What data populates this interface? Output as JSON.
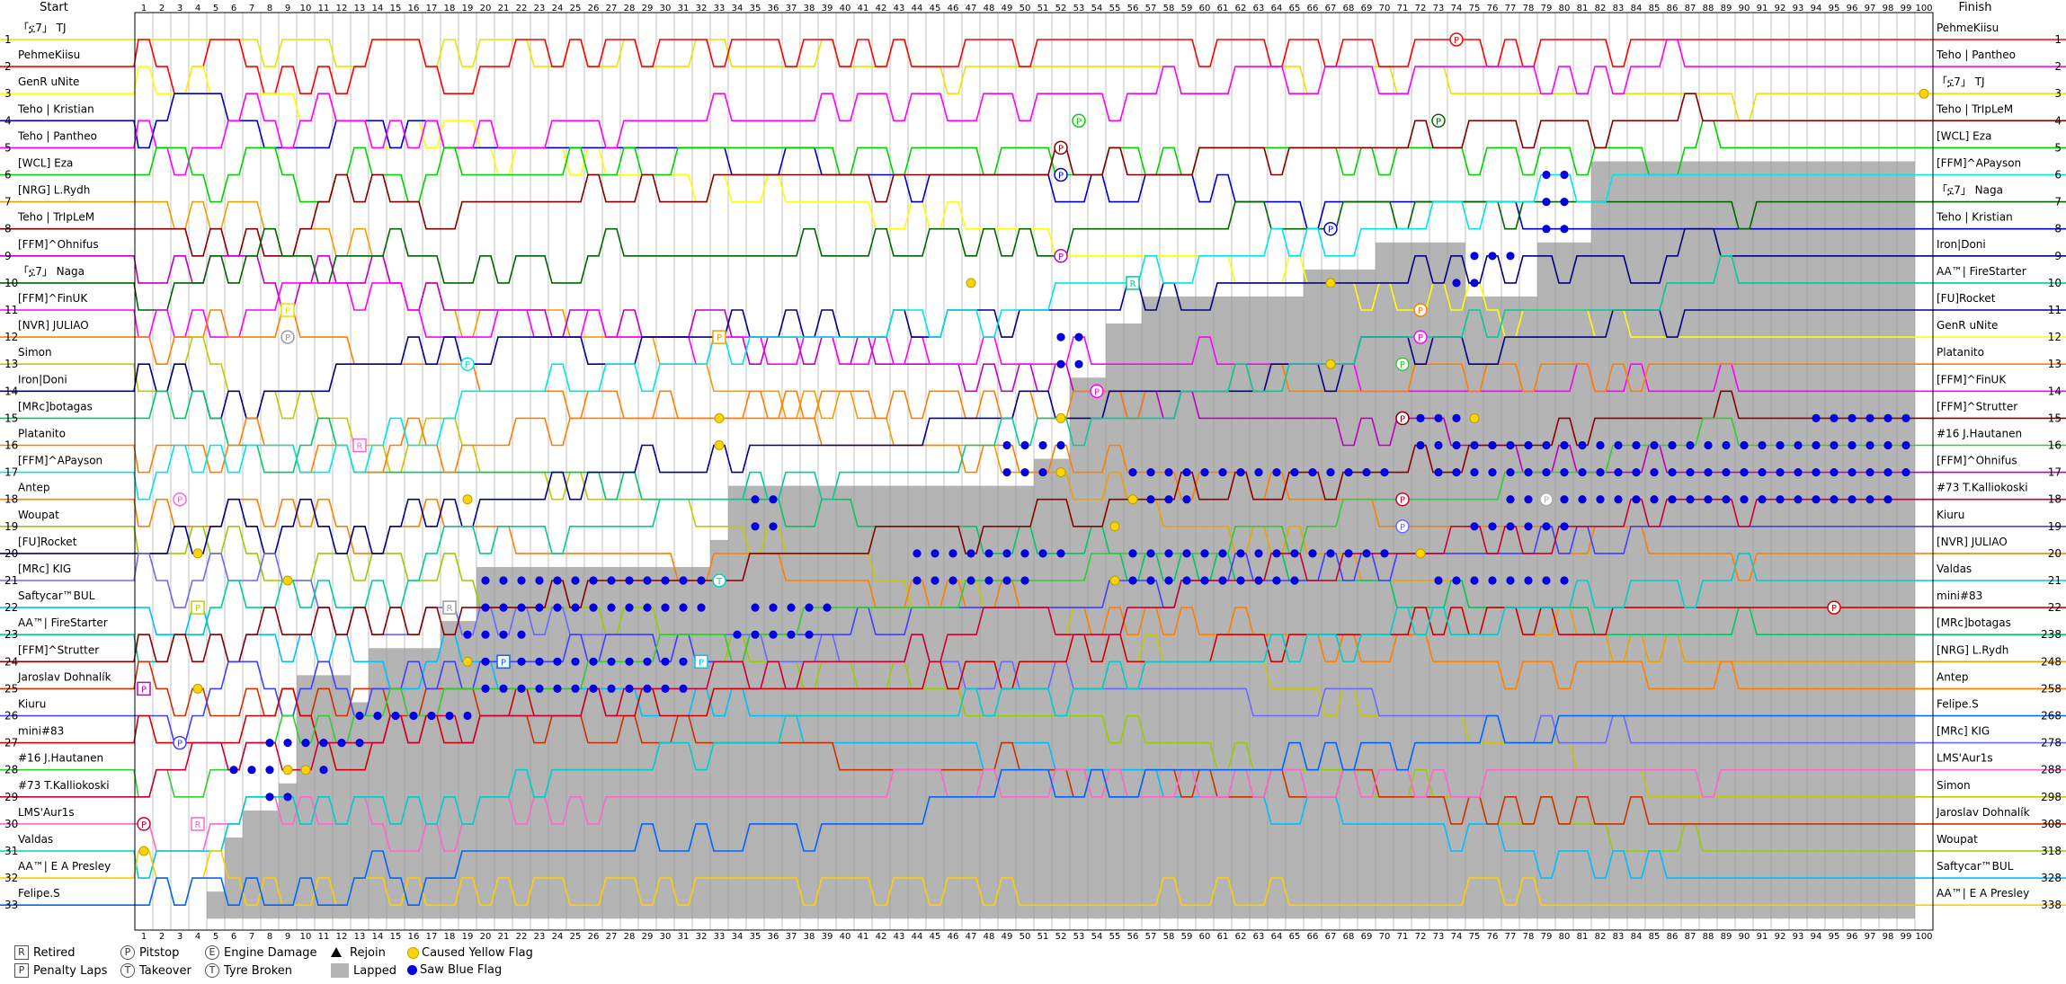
{
  "chart_data": {
    "type": "line",
    "title": "",
    "header_left": "Start",
    "header_right": "Finish",
    "laps": 100,
    "positions": 33,
    "start_order": [
      "「ኗ7」 TJ",
      "PehmeKiisu",
      "GenR uNite",
      "Teho | Kristian",
      "Teho | Pantheo",
      "[WCL] Eza",
      "[NRG] L.Rydh",
      "Teho | TrIpLeM",
      "[FFM]^Ohnifus",
      "「ኗ7」 Naga",
      "[FFM]^FinUK",
      "[NVR] JULIAO",
      "Simon",
      "Iron|Doni",
      "[MRc]botagas",
      "Platanito",
      "[FFM]^APayson",
      "Antep",
      "Woupat",
      "[FU]Rocket",
      "[MRc] KIG",
      "Saftycar™BUL",
      "AA™| FireStarter",
      "[FFM]^Strutter",
      "Jaroslav Dohnalík",
      "Kiuru",
      "mini#83",
      "#16 J.Hautanen",
      "#73 T.Kalliokoski",
      "LMS'Aur1s",
      "Valdas",
      "AA™| E A Presley",
      "Felipe.S"
    ],
    "finish_order": [
      "PehmeKiisu",
      "Teho | Pantheo",
      "「ኗ7」 TJ",
      "Teho | TrIpLeM",
      "[WCL] Eza",
      "[FFM]^APayson",
      "「ኗ7」 Naga",
      "Teho | Kristian",
      "Iron|Doni",
      "AA™| FireStarter",
      "[FU]Rocket",
      "GenR uNite",
      "Platanito",
      "[FFM]^FinUK",
      "[FFM]^Strutter",
      "#16 J.Hautanen",
      "[FFM]^Ohnifus",
      "#73 T.Kalliokoski",
      "Kiuru",
      "[NVR] JULIAO",
      "Valdas",
      "mini#83",
      "[MRc]botagas",
      "[NRG] L.Rydh",
      "Antep",
      "Felipe.S",
      "[MRc] KIG",
      "LMS'Aur1s",
      "Simon",
      "Jaroslav Dohnalík",
      "Woupat",
      "Saftycar™BUL",
      "AA™| E A Presley"
    ],
    "finish_labels": [
      "1",
      "2",
      "3",
      "4",
      "5",
      "6",
      "7",
      "8",
      "9",
      "10",
      "11",
      "12",
      "13",
      "14",
      "15",
      "16",
      "17",
      "18",
      "19",
      "20",
      "21",
      "22",
      "238",
      "248",
      "258",
      "268",
      "278",
      "288",
      "298",
      "308",
      "318",
      "328",
      "338"
    ],
    "driver_colors": {
      "「ኗ7」 TJ": "#e6e600",
      "PehmeKiisu": "#ff0000",
      "GenR uNite": "#ffff00",
      "Teho | Kristian": "#0000c8",
      "Teho | Pantheo": "#ff00ff",
      "[WCL] Eza": "#00d200",
      "[NRG] L.Rydh": "#f0a000",
      "Teho | TrIpLeM": "#800000",
      "[FFM]^Ohnifus": "#c000c0",
      "「ኗ7」 Naga": "#006400",
      "[FFM]^FinUK": "#ff00ff",
      "[NVR] JULIAO": "#ff8000",
      "Simon": "#c8c800",
      "Iron|Doni": "#000080",
      "[MRc]botagas": "#00c864",
      "Platanito": "#ff8000",
      "[FFM]^APayson": "#00e6e6",
      "Antep": "#ff7f00",
      "Woupat": "#99cc00",
      "[FU]Rocket": "#00008b",
      "[MRc] KIG": "#6a6aff",
      "Saftycar™BUL": "#00bfff",
      "AA™| FireStarter": "#00cc99",
      "[FFM]^Strutter": "#8b0000",
      "Jaroslav Dohnalík": "#cc3300",
      "Kiuru": "#4040ff",
      "mini#83": "#d20000",
      "#16 J.Hautanen": "#33cc33",
      "#73 T.Kalliokoski": "#cc0033",
      "LMS'Aur1s": "#ff66cc",
      "Valdas": "#00cccc",
      "AA™| E A Presley": "#ffcc00",
      "Felipe.S": "#0066ff"
    },
    "lapped_steps": [
      [
        5,
        33
      ],
      [
        6,
        31
      ],
      [
        7,
        30
      ],
      [
        9,
        29
      ],
      [
        10,
        25
      ],
      [
        13,
        26
      ],
      [
        14,
        24
      ],
      [
        18,
        23
      ],
      [
        20,
        21
      ],
      [
        33,
        20
      ],
      [
        34,
        18
      ],
      [
        51,
        17
      ],
      [
        53,
        14
      ],
      [
        55,
        12
      ],
      [
        57,
        11
      ],
      [
        66,
        10
      ],
      [
        70,
        9
      ],
      [
        75,
        11
      ],
      [
        79,
        9
      ],
      [
        82,
        6
      ],
      [
        100,
        6
      ]
    ],
    "markers": [
      {
        "type": "pitstop",
        "lap": 52,
        "pos": 5,
        "color": "#800000"
      },
      {
        "type": "pitstop",
        "lap": 52,
        "pos": 6,
        "color": "#0000c8"
      },
      {
        "type": "pitstop",
        "lap": 52,
        "pos": 9,
        "color": "#c000c0"
      },
      {
        "type": "pitstop",
        "lap": 53,
        "pos": 4,
        "color": "#00d200"
      },
      {
        "type": "pitstop",
        "lap": 73,
        "pos": 4,
        "color": "#006400"
      },
      {
        "type": "pitstop",
        "lap": 74,
        "pos": 1,
        "color": "#ff0000"
      },
      {
        "type": "pitstop",
        "lap": 67,
        "pos": 8,
        "color": "#0000c8"
      },
      {
        "type": "pitstop",
        "lap": 54,
        "pos": 14,
        "color": "#ff00ff"
      },
      {
        "type": "pitstop",
        "lap": 71,
        "pos": 15,
        "color": "#800000"
      },
      {
        "type": "pitstop",
        "lap": 71,
        "pos": 18,
        "color": "#cc0033"
      },
      {
        "type": "pitstop",
        "lap": 79,
        "pos": 18,
        "color": "#aaaaaa"
      },
      {
        "type": "pitstop",
        "lap": 95,
        "pos": 22,
        "color": "#d20000"
      },
      {
        "type": "pitstop",
        "lap": 72,
        "pos": 11,
        "color": "#ff8000"
      },
      {
        "type": "pitstop",
        "lap": 72,
        "pos": 12,
        "color": "#ff00ff"
      },
      {
        "type": "pitstop",
        "lap": 19,
        "pos": 13,
        "color": "#00e6e6"
      },
      {
        "type": "pitstop",
        "lap": 9,
        "pos": 12,
        "color": "#999999"
      },
      {
        "type": "pitstop",
        "lap": 3,
        "pos": 18,
        "color": "#ff66cc"
      },
      {
        "type": "pitstop",
        "lap": 3,
        "pos": 27,
        "color": "#4040ff"
      },
      {
        "type": "pitstop",
        "lap": 1,
        "pos": 30,
        "color": "#cc0033"
      },
      {
        "type": "pitstop",
        "lap": 71,
        "pos": 13,
        "color": "#33cc33"
      },
      {
        "type": "pitstop",
        "lap": 71,
        "pos": 19,
        "color": "#6a6aff"
      },
      {
        "type": "retired",
        "lap": 13,
        "pos": 16,
        "color": "#ff66cc"
      },
      {
        "type": "retired",
        "lap": 18,
        "pos": 22,
        "color": "#999999"
      },
      {
        "type": "retired",
        "lap": 4,
        "pos": 30,
        "color": "#ff66cc"
      },
      {
        "type": "retired",
        "lap": 56,
        "pos": 10,
        "color": "#00cc99"
      },
      {
        "type": "penalty",
        "lap": 1,
        "pos": 25,
        "color": "#c000c0"
      },
      {
        "type": "penalty",
        "lap": 4,
        "pos": 22,
        "color": "#cccc00"
      },
      {
        "type": "penalty",
        "lap": 9,
        "pos": 11,
        "color": "#e6e600"
      },
      {
        "type": "penalty",
        "lap": 33,
        "pos": 12,
        "color": "#f0a000"
      },
      {
        "type": "penalty",
        "lap": 21,
        "pos": 24,
        "color": "#0066ff"
      },
      {
        "type": "penalty",
        "lap": 32,
        "pos": 24,
        "color": "#00bfff"
      },
      {
        "type": "takeover",
        "lap": 33,
        "pos": 21,
        "color": "#00cccc"
      }
    ],
    "yellow_flags": [
      [
        1,
        30
      ],
      [
        1,
        31
      ],
      [
        9,
        28
      ],
      [
        10,
        28
      ],
      [
        4,
        25
      ],
      [
        4,
        20
      ],
      [
        9,
        21
      ],
      [
        19,
        18
      ],
      [
        19,
        24
      ],
      [
        33,
        15
      ],
      [
        33,
        16
      ],
      [
        33,
        12
      ],
      [
        47,
        10
      ],
      [
        52,
        15
      ],
      [
        52,
        17
      ],
      [
        55,
        19
      ],
      [
        55,
        21
      ],
      [
        56,
        18
      ],
      [
        67,
        10
      ],
      [
        67,
        13
      ],
      [
        72,
        20
      ],
      [
        75,
        15
      ],
      [
        100,
        3
      ]
    ],
    "blue_flag_rows": [
      {
        "pos": 21,
        "from": 20,
        "to": 32
      },
      {
        "pos": 22,
        "from": 20,
        "to": 32
      },
      {
        "pos": 23,
        "from": 19,
        "to": 22
      },
      {
        "pos": 24,
        "from": 20,
        "to": 32
      },
      {
        "pos": 25,
        "from": 20,
        "to": 31
      },
      {
        "pos": 26,
        "from": 13,
        "to": 19
      },
      {
        "pos": 27,
        "from": 8,
        "to": 13
      },
      {
        "pos": 28,
        "from": 6,
        "to": 11
      },
      {
        "pos": 29,
        "from": 8,
        "to": 9
      },
      {
        "pos": 22,
        "from": 35,
        "to": 39
      },
      {
        "pos": 23,
        "from": 34,
        "to": 38
      },
      {
        "pos": 18,
        "from": 35,
        "to": 36
      },
      {
        "pos": 19,
        "from": 35,
        "to": 36
      },
      {
        "pos": 16,
        "from": 49,
        "to": 52
      },
      {
        "pos": 17,
        "from": 49,
        "to": 52
      },
      {
        "pos": 17,
        "from": 56,
        "to": 70
      },
      {
        "pos": 20,
        "from": 56,
        "to": 70
      },
      {
        "pos": 21,
        "from": 56,
        "to": 65
      },
      {
        "pos": 18,
        "from": 56,
        "to": 59
      },
      {
        "pos": 20,
        "from": 44,
        "to": 52
      },
      {
        "pos": 21,
        "from": 44,
        "to": 50
      },
      {
        "pos": 15,
        "from": 72,
        "to": 74
      },
      {
        "pos": 16,
        "from": 72,
        "to": 99
      },
      {
        "pos": 17,
        "from": 73,
        "to": 99
      },
      {
        "pos": 18,
        "from": 77,
        "to": 98
      },
      {
        "pos": 19,
        "from": 75,
        "to": 80
      },
      {
        "pos": 21,
        "from": 73,
        "to": 80
      },
      {
        "pos": 15,
        "from": 94,
        "to": 99
      },
      {
        "pos": 6,
        "from": 79,
        "to": 80
      },
      {
        "pos": 7,
        "from": 79,
        "to": 80
      },
      {
        "pos": 8,
        "from": 79,
        "to": 80
      },
      {
        "pos": 9,
        "from": 75,
        "to": 77
      },
      {
        "pos": 10,
        "from": 74,
        "to": 75
      },
      {
        "pos": 12,
        "from": 52,
        "to": 53
      },
      {
        "pos": 13,
        "from": 52,
        "to": 53
      }
    ]
  },
  "legend": {
    "retired": "Retired",
    "penalty_laps": "Penalty Laps",
    "pitstop": "Pitstop",
    "takeover": "Takeover",
    "engine_damage": "Engine Damage",
    "tyre_broken": "Tyre Broken",
    "rejoin": "Rejoin",
    "lapped": "Lapped",
    "caused_yellow_flag": "Caused Yellow Flag",
    "saw_blue_flag": "Saw Blue Flag",
    "icon_retired": "R",
    "icon_pitstop": "P",
    "icon_engine": "E",
    "icon_penalty": "P",
    "icon_takeover": "T",
    "icon_tyre": "T"
  }
}
